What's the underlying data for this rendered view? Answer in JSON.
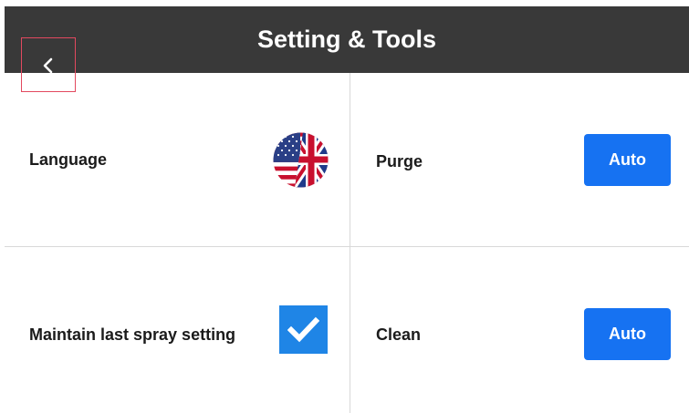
{
  "header": {
    "title": "Setting & Tools",
    "back_icon": "chevron-left-icon",
    "background": "#393939"
  },
  "settings": {
    "language_label": "Language",
    "language_icon": "us-uk-flag-icon",
    "purge_label": "Purge",
    "purge_button": "Auto",
    "maintain_label": "Maintain last spray setting",
    "maintain_checked": true,
    "clean_label": "Clean",
    "clean_button": "Auto"
  },
  "colors": {
    "accent": "#1672f2",
    "checkbox": "#1f85e6",
    "focus_outline": "#e2495f"
  }
}
